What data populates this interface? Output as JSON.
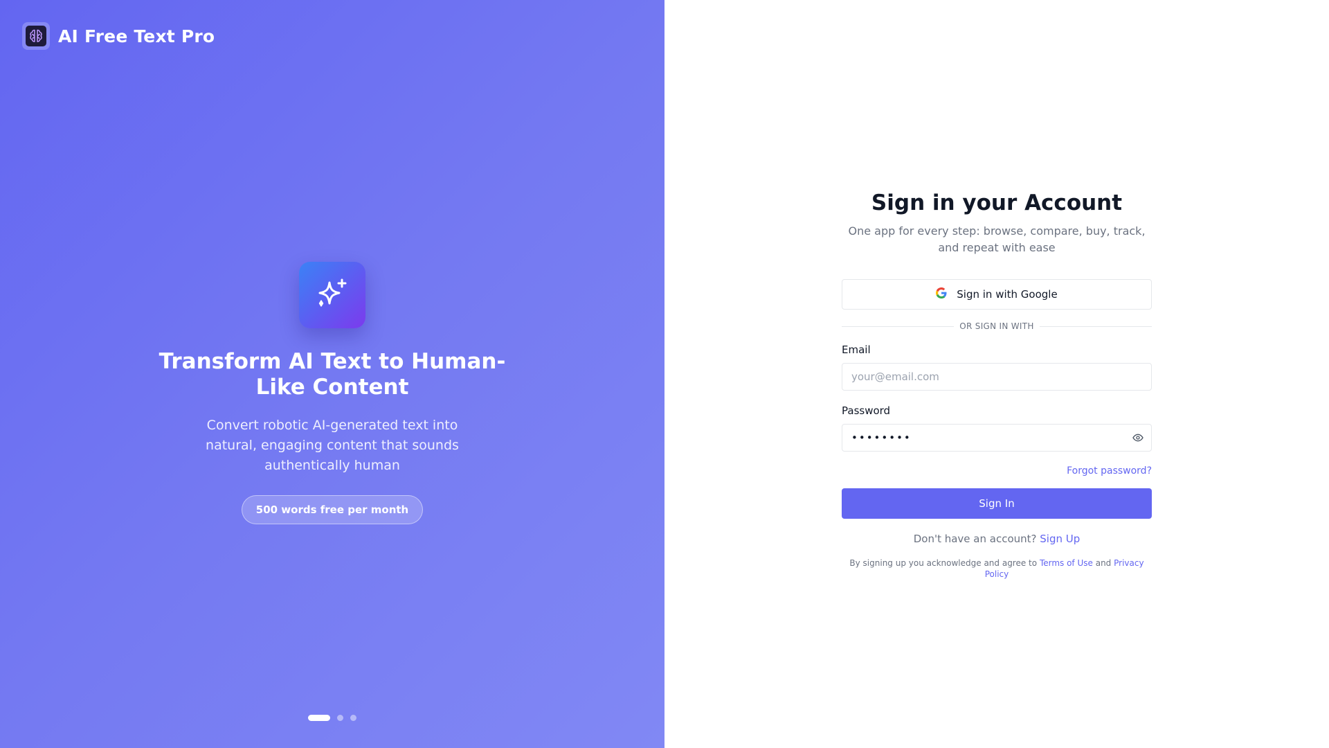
{
  "brand": {
    "name": "AI Free Text Pro",
    "logo_icon": "brain-icon"
  },
  "hero": {
    "icon": "sparkles-icon",
    "title": "Transform AI Text to Human-Like Content",
    "description": "Convert robotic AI-generated text into natural, engaging content that sounds authentically human",
    "badge": "500 words free per month"
  },
  "carousel": {
    "count": 3,
    "active_index": 0
  },
  "form": {
    "title": "Sign in your Account",
    "subtitle": "One app for every step: browse, compare, buy, track, and repeat with ease",
    "google_label": "Sign in with Google",
    "divider": "OR SIGN IN WITH",
    "email_label": "Email",
    "email_placeholder": "your@email.com",
    "password_label": "Password",
    "password_value": "12345678",
    "forgot_label": "Forgot password?",
    "submit_label": "Sign In",
    "signup_prompt": "Don't have an account?",
    "signup_link": "Sign Up",
    "legal_prefix": "By signing up you acknowledge and agree to",
    "terms_link": "Terms of Use",
    "legal_and": "and",
    "privacy_link": "Privacy Policy"
  },
  "colors": {
    "accent": "#6366f1",
    "panel_gradient_start": "#6366f1",
    "panel_gradient_end": "#8188f4",
    "hero_icon_start": "#3b82f6",
    "hero_icon_end": "#7c3aed"
  }
}
